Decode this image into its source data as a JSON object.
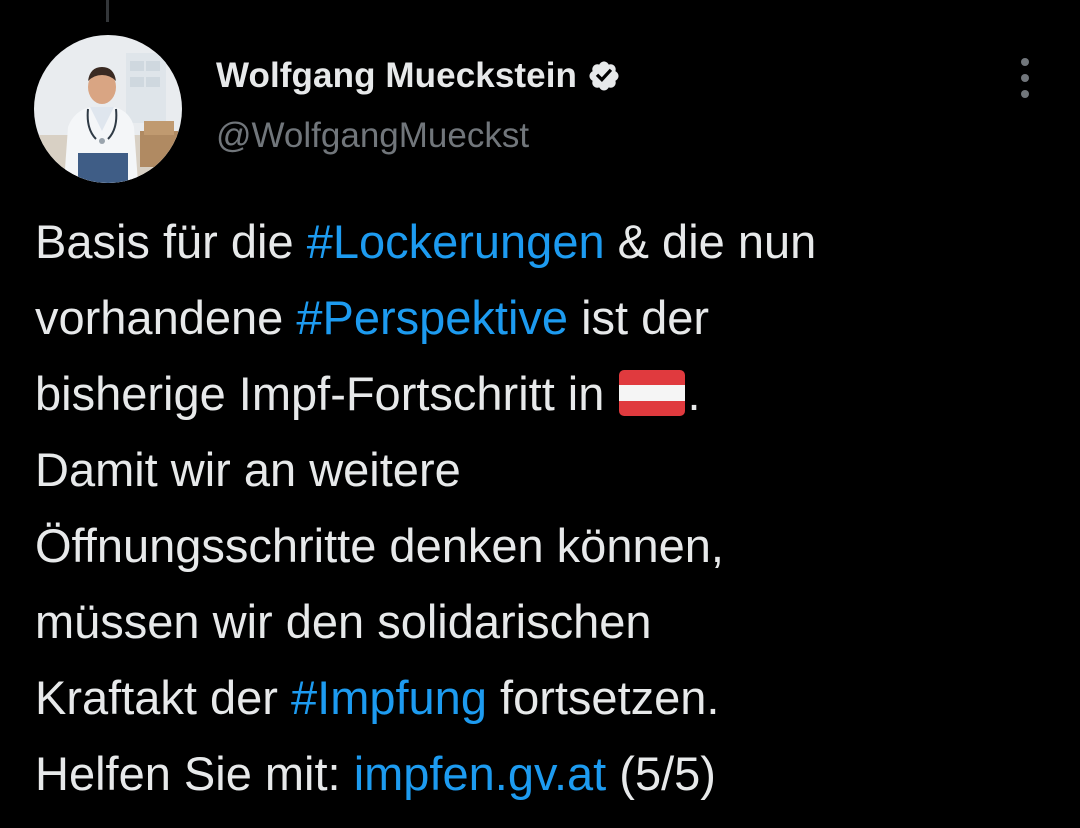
{
  "tweet": {
    "author": {
      "display_name": "Wolfgang Mueckstein",
      "handle": "@WolfgangMueckst",
      "verified": true
    },
    "text": {
      "l1_a": "Basis für die ",
      "l1_tag": "#Lockerungen",
      "l1_b": " & die nun",
      "l2_a": "vorhandene ",
      "l2_tag": "#Perspektive",
      "l2_b": " ist der",
      "l3_a": "bisherige Impf-Fortschritt in ",
      "l3_flag": "austria-flag-emoji",
      "l3_b": ".",
      "l4": "Damit wir an weitere",
      "l5": "Öffnungsschritte denken können,",
      "l6": "müssen wir den solidarischen",
      "l7_a": "Kraftakt der ",
      "l7_tag": "#Impfung",
      "l7_b": " fortsetzen.",
      "l8_a": "Helfen Sie mit: ",
      "l8_link": "impfen.gv.at",
      "l8_b": " (5/5)"
    }
  },
  "colors": {
    "background": "#000000",
    "text": "#e7e9ea",
    "secondary": "#71767b",
    "link": "#1d9bf0",
    "verified": "#e7e9ea"
  },
  "icons": {
    "verified": "verified-badge-icon",
    "more": "more-options-icon"
  }
}
